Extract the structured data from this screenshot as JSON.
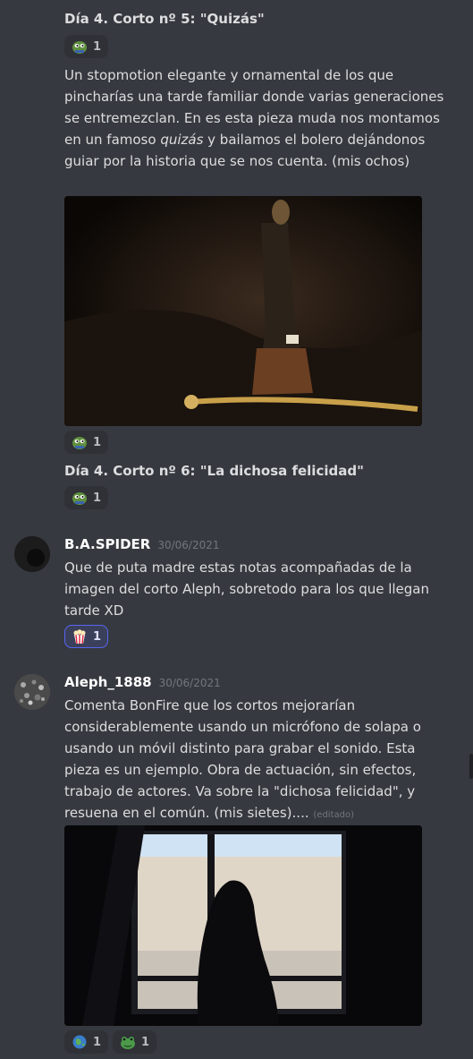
{
  "messages": {
    "m1": {
      "title": "Día 4. Corto nº 5: \"Quizás\"",
      "reaction_count": "1",
      "body_pre": "Un stopmotion elegante y ornamental de los que pincharías una tarde familiar donde varias generaciones se entremezclan. En es esta pieza muda nos montamos en un famoso ",
      "body_em": "quizás",
      "body_post": " y bailamos el bolero dejándonos guiar por la historia que se nos cuenta. (mis ochos)",
      "image_reaction_count": "1"
    },
    "m2": {
      "title": "Día 4. Corto nº 6: \"La dichosa felicidad\"",
      "reaction_count": "1"
    },
    "m3": {
      "username": "B.A.SPIDER",
      "timestamp": "30/06/2021",
      "body": "Que de puta madre estas notas acompañadas de la imagen del corto Aleph, sobretodo para los que llegan tarde XD",
      "reaction_count": "1"
    },
    "m4": {
      "username": "Aleph_1888",
      "timestamp": "30/06/2021",
      "body": "Comenta BonFire que los cortos mejorarían considerablemente usando un micrófono de solapa o usando un móvil distinto para grabar el sonido. Esta pieza es un ejemplo. Obra de actuación, sin efectos, trabajo de actores. Va sobre la \"dichosa felicidad\", y resuena en el común. (mis sietes)....",
      "edited": "(editado)",
      "reaction1_count": "1",
      "reaction2_count": "1"
    }
  },
  "icons": {
    "pepe_reaction": "pepe-emoji-icon",
    "popcorn_reaction": "popcorn-emoji-icon",
    "globe_reaction": "globe-emoji-icon",
    "frog_reaction": "frog-emoji-icon"
  },
  "colors": {
    "background": "#36393f",
    "reaction_bg": "#2f3136",
    "reaction_active_bg": "#3b405a",
    "reaction_active_border": "#5865f2",
    "text": "#dcddde",
    "muted": "#72767d"
  }
}
